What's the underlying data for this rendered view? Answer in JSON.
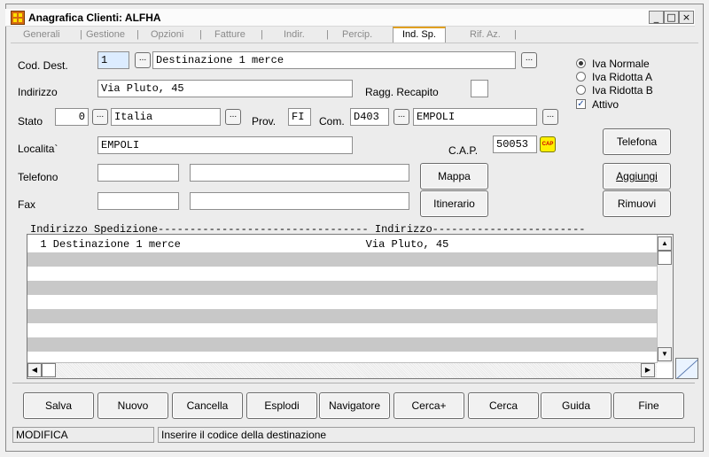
{
  "window": {
    "title": "Anagrafica Clienti: ALFHA",
    "controls": [
      "_",
      "□",
      "×"
    ]
  },
  "tabs": [
    {
      "label": "Generali"
    },
    {
      "label": "Gestione"
    },
    {
      "label": "Opzioni"
    },
    {
      "label": "Fatture"
    },
    {
      "label": "Indir."
    },
    {
      "label": "Percip."
    },
    {
      "label": "Ind. Sp.",
      "active": true
    },
    {
      "label": "Rif. Az."
    }
  ],
  "form": {
    "cod_dest_label": "Cod. Dest.",
    "cod_dest_value": "1",
    "descrizione_value": "Destinazione 1 merce",
    "indirizzo_label": "Indirizzo",
    "indirizzo_value": "Via Pluto, 45",
    "ragg_recapito_label": "Ragg. Recapito",
    "stato_label": "Stato",
    "stato_code": "0",
    "stato_name": "Italia",
    "prov_label": "Prov.",
    "prov_value": "FI",
    "com_label": "Com.",
    "com_code": "D403",
    "com_name": "EMPOLI",
    "localita_label": "Localita`",
    "localita_value": "EMPOLI",
    "cap_label": "C.A.P.",
    "cap_value": "50053",
    "cap_icon": "CAP",
    "telefono_label": "Telefono",
    "fax_label": "Fax",
    "dots": "..."
  },
  "iva": {
    "options": [
      {
        "label": "Iva Normale",
        "selected": true
      },
      {
        "label": "Iva Ridotta A",
        "selected": false
      },
      {
        "label": "Iva Ridotta B",
        "selected": false
      }
    ],
    "attivo_label": "Attivo",
    "attivo_checked": true
  },
  "buttons": {
    "telefona": "Telefona",
    "mappa": "Mappa",
    "aggiungi": "Aggiungi",
    "itinerario": "Itinerario",
    "rimuovi": "Rimuovi"
  },
  "list": {
    "header": "Indirizzo Spedizione--------------------------------- Indirizzo------------------------",
    "rows": [
      {
        "text": "  1 Destinazione 1 merce                             Via Pluto, 45"
      }
    ]
  },
  "toolbar": [
    "Salva",
    "Nuovo",
    "Cancella",
    "Esplodi",
    "Navigatore",
    "Cerca+",
    "Cerca",
    "Guida",
    "Fine"
  ],
  "status": {
    "mode": "MODIFICA",
    "message": "Inserire il codice della destinazione"
  }
}
